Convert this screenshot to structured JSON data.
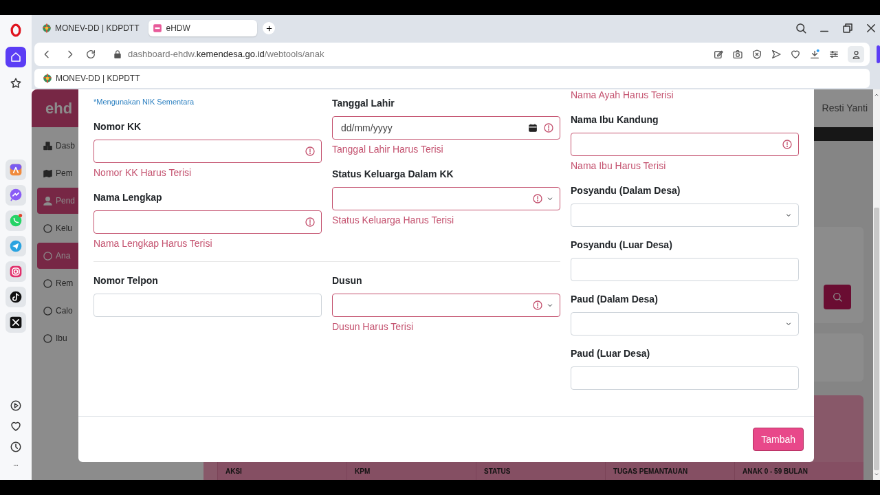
{
  "browser": {
    "tabs": [
      {
        "title": "MONEV-DD | KDPDTT",
        "selected": false
      },
      {
        "title": "eHDW",
        "selected": true
      }
    ],
    "address": {
      "prefix": "dashboard-ehdw.",
      "domain": "kemendesa.go.id",
      "path": "/webtools/anak"
    },
    "bookmarks": [
      {
        "title": "MONEV-DD | KDPDTT"
      }
    ]
  },
  "app": {
    "logo": "ehd",
    "sidebar_items": [
      {
        "kind": "cubes",
        "label": "Dasb",
        "selected": false
      },
      {
        "kind": "map",
        "label": "Pem",
        "selected": false
      },
      {
        "kind": "person",
        "label": "Pend",
        "selected": true
      },
      {
        "kind": "circle",
        "label": "Kelu",
        "selected": false
      },
      {
        "kind": "circle",
        "label": "Ana",
        "selected": true
      },
      {
        "kind": "circle",
        "label": "Rem",
        "selected": false
      },
      {
        "kind": "circle",
        "label": "Calo",
        "selected": false
      },
      {
        "kind": "circle",
        "label": "Ibu",
        "selected": false
      }
    ],
    "user": "Resti Yanti",
    "table_columns": [
      "AKSI",
      "KPM",
      "STATUS",
      "TUGAS PEMANTAUAN",
      "ANAK 0 - 59 BULAN"
    ]
  },
  "modal": {
    "groups": [
      {
        "columns": [
          [
            {
              "kind": "note",
              "text": "*Mengunakan NIK Sementara"
            },
            {
              "kind": "input",
              "label": "Nomor KK",
              "invalid": true,
              "error": "Nomor KK Harus Terisi"
            },
            {
              "kind": "input",
              "label": "Nama Lengkap",
              "invalid": true,
              "error": "Nama Lengkap Harus Terisi"
            }
          ],
          [
            {
              "kind": "date",
              "label": "Tanggal Lahir",
              "placeholder": "dd/mm/yyyy",
              "invalid": true,
              "error": "Tanggal Lahir Harus Terisi"
            },
            {
              "kind": "select",
              "label": "Status Keluarga Dalam KK",
              "invalid": true,
              "error": "Status Keluarga Harus Terisi"
            }
          ]
        ]
      },
      {
        "columns": [
          [
            {
              "kind": "input",
              "label": "Nomor Telpon",
              "invalid": false
            }
          ],
          [
            {
              "kind": "select",
              "label": "Dusun",
              "invalid": true,
              "error": "Dusun Harus Terisi"
            }
          ]
        ]
      }
    ],
    "side_column": [
      {
        "kind": "error",
        "text": "Nama Ayah Harus Terisi"
      },
      {
        "kind": "input",
        "label": "Nama Ibu Kandung",
        "invalid": true,
        "error": "Nama Ibu Harus Terisi"
      },
      {
        "kind": "select",
        "label": "Posyandu (Dalam Desa)",
        "invalid": false
      },
      {
        "kind": "input",
        "label": "Posyandu (Luar Desa)",
        "invalid": false
      },
      {
        "kind": "select",
        "label": "Paud (Dalam Desa)",
        "invalid": false
      },
      {
        "kind": "input",
        "label": "Paud (Luar Desa)",
        "invalid": false
      }
    ],
    "submit": "Tambah"
  }
}
